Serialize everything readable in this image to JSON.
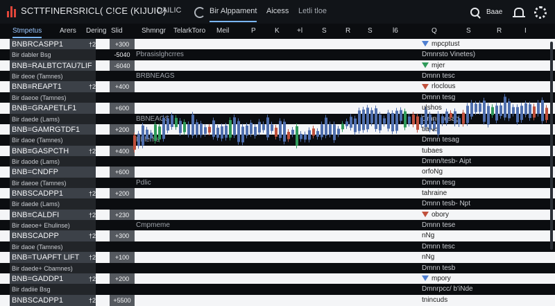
{
  "app": {
    "title": "SCTTFINERSRICL( C!CE (KIJUIC)",
    "subtitle": "DAILIC",
    "tabs": [
      {
        "label": "Bir Alppament",
        "active": true
      },
      {
        "label": "Aicess",
        "active": false
      },
      {
        "label": "Letli tloe",
        "active": false
      }
    ],
    "base_label": "Baae"
  },
  "columns": [
    {
      "label": "Stmpetus",
      "active": true
    },
    {
      "label": "Arers",
      "active": false
    },
    {
      "label": "Dering",
      "active": false
    },
    {
      "label": "Slid",
      "active": false
    },
    {
      "label": "Shmngr",
      "active": false
    },
    {
      "label": "TelarkToro",
      "active": false
    },
    {
      "label": "Meil",
      "active": false
    },
    {
      "label": "P",
      "active": false
    },
    {
      "label": "K",
      "active": false
    },
    {
      "label": "+l",
      "active": false
    },
    {
      "label": "S",
      "active": false
    },
    {
      "label": "R",
      "active": false
    },
    {
      "label": "S",
      "active": false
    },
    {
      "label": "l6",
      "active": false
    },
    {
      "label": "Q",
      "active": false
    },
    {
      "label": "S",
      "active": false
    },
    {
      "label": "R",
      "active": false
    },
    {
      "label": "I",
      "active": false
    }
  ],
  "rows": [
    {
      "type": "main",
      "symbol": "BNBRCASPP1",
      "qty": "†2",
      "change": "+300",
      "overlay": "",
      "note": "mpcptust",
      "marker": "blue"
    },
    {
      "type": "sub",
      "symbol": "Bir dabler Bsg",
      "qty": "",
      "change": "-5040",
      "overlay": "Pbrasislghcrres",
      "note": "Dmnrsto Vinetes)",
      "marker": ""
    },
    {
      "type": "main",
      "symbol": "BNB=RALBTCTAU7LIF",
      "qty": "",
      "change": "-6040",
      "overlay": "",
      "note": "mjer",
      "marker": "green"
    },
    {
      "type": "sub",
      "symbol": "Bir deoe (Tamnes)",
      "qty": "",
      "change": "",
      "overlay": "BRBNEAGS",
      "note": "Dmnn tesc",
      "marker": ""
    },
    {
      "type": "main",
      "symbol": "BNB≡REAPT1",
      "qty": "†2",
      "change": "+400",
      "overlay": "",
      "note": "rloclous",
      "marker": "red"
    },
    {
      "type": "sub",
      "symbol": "Bir daeoe (Tamnes)",
      "qty": "",
      "change": "",
      "overlay": "",
      "note": "Dmnn tesg",
      "marker": ""
    },
    {
      "type": "main",
      "symbol": "BNB=GRAPETLF1",
      "qty": "",
      "change": "+600",
      "overlay": "",
      "note": "ulshos",
      "marker": ""
    },
    {
      "type": "sub",
      "symbol": "Bir daede (Lams)",
      "qty": "",
      "change": "",
      "overlay": "BBNEAGS",
      "note": "Dmnn tesag",
      "marker": ""
    },
    {
      "type": "main",
      "symbol": "BNB=GAMRGTDF1",
      "qty": "",
      "change": "+200",
      "overlay": "",
      "note": "tiaNe",
      "marker": ""
    },
    {
      "type": "sub",
      "symbol": "Bir daoe (Tamnes)",
      "qty": "",
      "change": "",
      "overlay": "Phlerhs",
      "note": "Dmnn tesag",
      "marker": ""
    },
    {
      "type": "main",
      "symbol": "BNB≡GASPCTH",
      "qty": "†2",
      "change": "+400",
      "overlay": "",
      "note": "tubaes",
      "marker": ""
    },
    {
      "type": "sub",
      "symbol": "Bir daode (Lams)",
      "qty": "",
      "change": "",
      "overlay": "",
      "note": "Dmnn/tesb- Aipt",
      "marker": ""
    },
    {
      "type": "main",
      "symbol": "BNB=CNDFP",
      "qty": "",
      "change": "+600",
      "overlay": "",
      "note": "orfoNg",
      "marker": ""
    },
    {
      "type": "sub",
      "symbol": "Bir daeoe (Tamnes)",
      "qty": "",
      "change": "",
      "overlay": "Pdlic",
      "note": "Dmnn tesg",
      "marker": ""
    },
    {
      "type": "main",
      "symbol": "BNBSCADPP1",
      "qty": "†2",
      "change": "+200",
      "overlay": "",
      "note": "tahraine",
      "marker": ""
    },
    {
      "type": "sub",
      "symbol": "Bir daede (Lams)",
      "qty": "",
      "change": "",
      "overlay": "",
      "note": "Dmnn tesb- Npt",
      "marker": ""
    },
    {
      "type": "main",
      "symbol": "BNB≡CALDFI",
      "qty": "†2",
      "change": "+230",
      "overlay": "",
      "note": "obory",
      "marker": "red"
    },
    {
      "type": "sub",
      "symbol": "Bir daeoe+ Ehulinse)",
      "qty": "",
      "change": "",
      "overlay": "Cmpmeme",
      "note": "Dmnn tese",
      "marker": ""
    },
    {
      "type": "main",
      "symbol": "BNBSCADPP",
      "qty": "†2",
      "change": "+300",
      "overlay": "",
      "note": "nNg",
      "marker": ""
    },
    {
      "type": "sub",
      "symbol": "Bir daoe (Tamnes)",
      "qty": "",
      "change": "",
      "overlay": "",
      "note": "Dmnn tesc",
      "marker": ""
    },
    {
      "type": "main",
      "symbol": "BNB=TUAPFT LIFT",
      "qty": "†2",
      "change": "+100",
      "overlay": "",
      "note": "nNg",
      "marker": ""
    },
    {
      "type": "sub",
      "symbol": "Bir daede+ Cbamnes)",
      "qty": "",
      "change": "",
      "overlay": "",
      "note": "Dmnn tesb",
      "marker": ""
    },
    {
      "type": "main",
      "symbol": "BNB=GADDP1",
      "qty": "†2",
      "change": "+200",
      "overlay": "",
      "note": "mpory",
      "marker": "blue"
    },
    {
      "type": "sub",
      "symbol": "Bir dadiie Bsg",
      "qty": "",
      "change": "",
      "overlay": "",
      "note": "Dmnrpcc/ b'iNde",
      "marker": ""
    },
    {
      "type": "main",
      "symbol": "BNBSCADPP1",
      "qty": "†2",
      "change": "+5500",
      "overlay": "",
      "note": "tnincuds",
      "marker": ""
    }
  ],
  "colors": {
    "up": "#2f9a5a",
    "down": "#c0503c",
    "candle": "#4f6fae",
    "accent": "#7ab6ff"
  },
  "icons": [
    "brand-logo-icon",
    "refresh-icon",
    "search-icon",
    "bell-icon",
    "gear-icon"
  ]
}
